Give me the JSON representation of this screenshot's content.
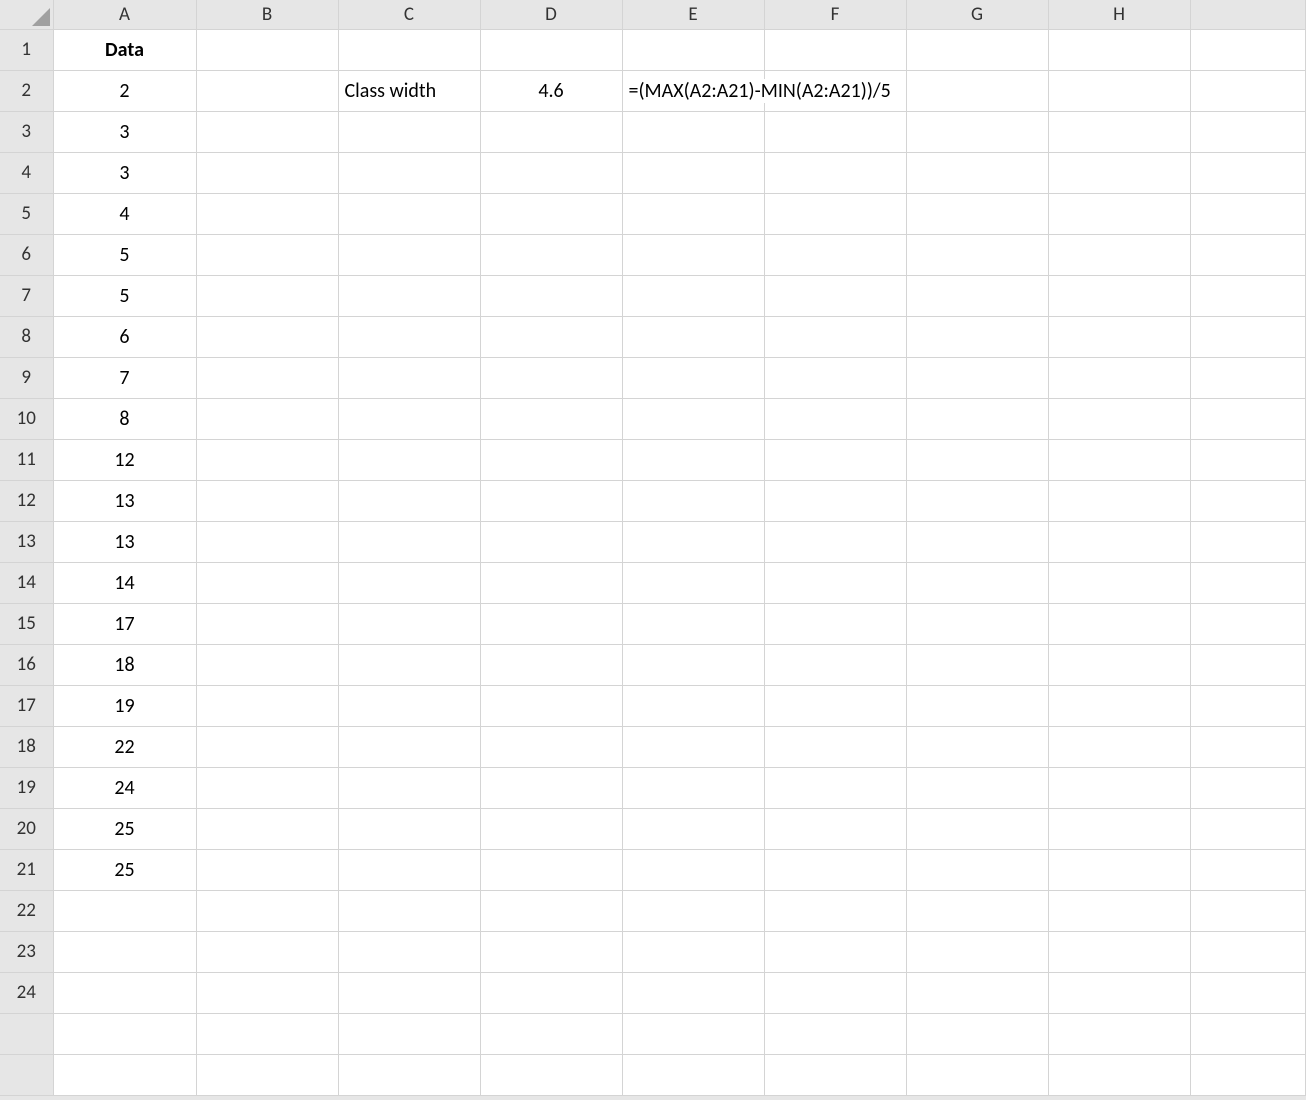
{
  "columns": [
    "A",
    "B",
    "C",
    "D",
    "E",
    "F",
    "G",
    "H"
  ],
  "rows": [
    "1",
    "2",
    "3",
    "4",
    "5",
    "6",
    "7",
    "8",
    "9",
    "10",
    "11",
    "12",
    "13",
    "14",
    "15",
    "16",
    "17",
    "18",
    "19",
    "20",
    "21",
    "22",
    "23",
    "24"
  ],
  "cells": {
    "A1": "Data",
    "A2": "2",
    "A3": "3",
    "A4": "3",
    "A5": "4",
    "A6": "5",
    "A7": "5",
    "A8": "6",
    "A9": "7",
    "A10": "8",
    "A11": "12",
    "A12": "13",
    "A13": "13",
    "A14": "14",
    "A15": "17",
    "A16": "18",
    "A17": "19",
    "A18": "22",
    "A19": "24",
    "A20": "25",
    "A21": "25",
    "C2": "Class width",
    "D2": "4.6",
    "E2": "=(MAX(A2:A21)-MIN(A2:A21))/5"
  }
}
